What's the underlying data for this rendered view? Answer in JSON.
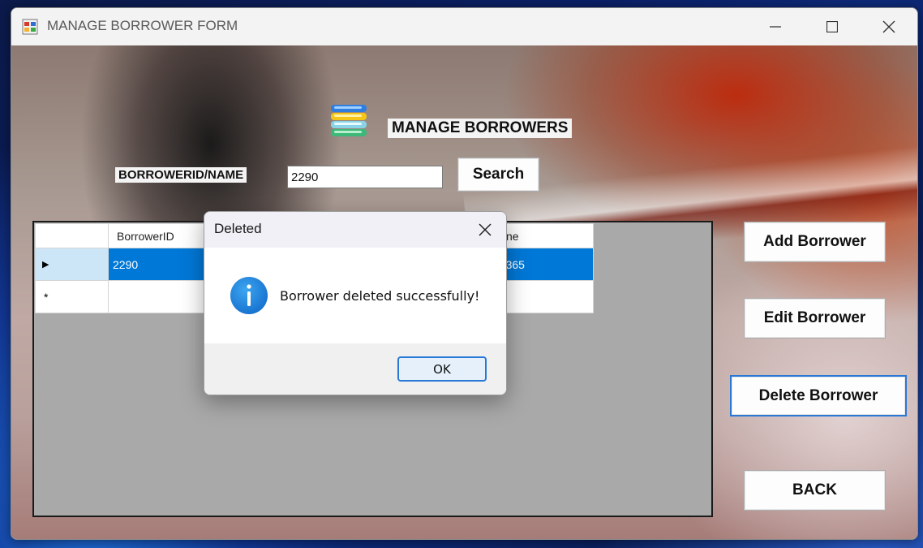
{
  "window": {
    "title": "MANAGE BORROWER FORM",
    "controls": [
      "minimize",
      "maximize",
      "close"
    ]
  },
  "form": {
    "heading": "MANAGE BORROWERS",
    "search": {
      "label": "BORROWERID/NAME",
      "value": "2290",
      "button_label": "Search"
    },
    "buttons": {
      "add": "Add Borrower",
      "edit": "Edit Borrower",
      "delete": "Delete Borrower",
      "back": "BACK"
    },
    "grid": {
      "columns": [
        "BorrowerID",
        "ne"
      ],
      "rows": [
        {
          "row_marker": "▶",
          "cells": [
            "2290",
            "54365"
          ],
          "selected": true
        },
        {
          "row_marker": "*",
          "cells": [
            "",
            ""
          ],
          "selected": false
        }
      ]
    }
  },
  "dialog": {
    "title": "Deleted",
    "message": "Borrower deleted successfully!",
    "icon": "info-icon",
    "ok_label": "OK"
  },
  "colors": {
    "selection": "#0078d7",
    "accent_border": "#2a78d6",
    "grid_background": "#a9a9a9"
  }
}
